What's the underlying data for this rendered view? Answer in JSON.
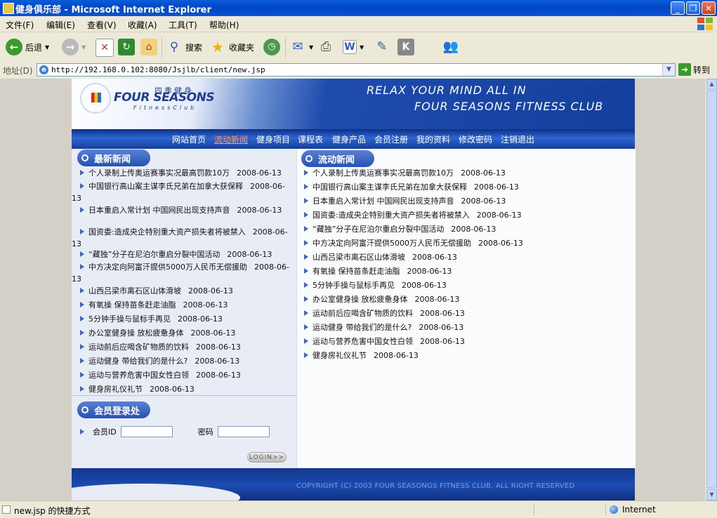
{
  "window": {
    "title": "健身俱乐部 - Microsoft Internet Explorer",
    "controls": [
      "_",
      "❐",
      "✕"
    ]
  },
  "menu": [
    "文件(F)",
    "编辑(E)",
    "查看(V)",
    "收藏(A)",
    "工具(T)",
    "帮助(H)"
  ],
  "toolbar": {
    "back_label": "后退",
    "search_label": "搜索",
    "favorites_label": "收藏夹"
  },
  "address": {
    "label": "地址(D)",
    "url": "http://192.168.0.102:8080/Jsjlb/client/new.jsp",
    "go_label": "转到"
  },
  "site": {
    "logo_cn": "四季健身",
    "logo_en": "FOUR SEASONS",
    "logo_sub": "FitnessClub",
    "slogan_line1": "RELAX YOUR MIND ALL IN",
    "slogan_line2": "FOUR SEASONS FITNESS CLUB",
    "nav": [
      "网站首页",
      "流动新闻",
      "健身项目",
      "课程表",
      "健身产品",
      "会员注册",
      "我的资料",
      "修改密码",
      "注销退出"
    ],
    "nav_active": "流动新闻",
    "latest_news_title": "最新新闻",
    "latest_news": [
      {
        "title": "个人录制上传奥运赛事实况最高罚款10万",
        "date": "2008-06-13"
      },
      {
        "title": "中国银行高山案主谋李氏兄弟在加拿大获保释",
        "date": "2008-06-13"
      },
      {
        "title": "日本重启入常计划 中国网民出现支持声音",
        "date": "2008-06-13"
      },
      {
        "title": "国资委:造成央企特别重大资产损失者将被禁入",
        "date": "2008-06-13"
      },
      {
        "title": "“藏独”分子在尼泊尔重启分裂中国活动",
        "date": "2008-06-13"
      },
      {
        "title": "中方决定向阿富汗提供5000万人民币无偿援助",
        "date": "2008-06-13"
      },
      {
        "title": "山西吕梁市离石区山体滑坡",
        "date": "2008-06-13"
      },
      {
        "title": "有氧操 保持苗条赶走油脂",
        "date": "2008-06-13"
      },
      {
        "title": "5分钟手操与鼠标手再见",
        "date": "2008-06-13"
      },
      {
        "title": "办公室健身操 放松疲惫身体",
        "date": "2008-06-13"
      },
      {
        "title": "运动前后应喝含矿物质的饮料",
        "date": "2008-06-13"
      },
      {
        "title": "运动健身 带给我们的是什么?",
        "date": "2008-06-13"
      },
      {
        "title": "运动与营养危害中国女性白领",
        "date": "2008-06-13"
      },
      {
        "title": "健身房礼仪礼节",
        "date": "2008-06-13"
      }
    ],
    "rolling_news_title": "流动新闻",
    "rolling_news": [
      {
        "title": "个人录制上传奥运赛事实况最高罚款10万",
        "date": "2008-06-13"
      },
      {
        "title": "中国银行高山案主谋李氏兄弟在加拿大获保释",
        "date": "2008-06-13"
      },
      {
        "title": "日本重启入常计划 中国网民出现支持声音",
        "date": "2008-06-13"
      },
      {
        "title": "国资委:造成央企特别重大资产损失者将被禁入",
        "date": "2008-06-13"
      },
      {
        "title": "“藏独”分子在尼泊尔重启分裂中国活动",
        "date": "2008-06-13"
      },
      {
        "title": "中方决定向阿富汗提供5000万人民币无偿援助",
        "date": "2008-06-13"
      },
      {
        "title": "山西吕梁市离石区山体滑坡",
        "date": "2008-06-13"
      },
      {
        "title": "有氧操 保持苗条赶走油脂",
        "date": "2008-06-13"
      },
      {
        "title": "5分钟手操与鼠标手再见",
        "date": "2008-06-13"
      },
      {
        "title": "办公室健身操 放松疲惫身体",
        "date": "2008-06-13"
      },
      {
        "title": "运动前后应喝含矿物质的饮料",
        "date": "2008-06-13"
      },
      {
        "title": "运动健身 带给我们的是什么?",
        "date": "2008-06-13"
      },
      {
        "title": "运动与营养危害中国女性白领",
        "date": "2008-06-13"
      },
      {
        "title": "健身房礼仪礼节",
        "date": "2008-06-13"
      }
    ],
    "login": {
      "title": "会员登录处",
      "id_label": "会员ID",
      "password_label": "密码",
      "button_label": "LOGIN>>"
    },
    "copyright": "COPYRIGHT (C) 2003 FOUR SEASONGS FITNESS CLUB. ALL RIGHT RESERVED"
  },
  "status": {
    "text": "new.jsp  的快捷方式",
    "zone": "Internet"
  },
  "colors": {
    "title_bar": "#0a5ed8",
    "banner_blue": "#143f9e",
    "nav_active": "#ff9a66",
    "panel_bg": "#e8edf5"
  },
  "icons": [
    "ie-icon",
    "back-icon",
    "forward-icon",
    "stop-icon",
    "refresh-icon",
    "home-icon",
    "search-icon",
    "favorites-icon",
    "history-icon",
    "mail-icon",
    "print-icon",
    "edit-icon",
    "messenger-icon",
    "windows-logo-icon",
    "go-icon",
    "globe-icon"
  ]
}
